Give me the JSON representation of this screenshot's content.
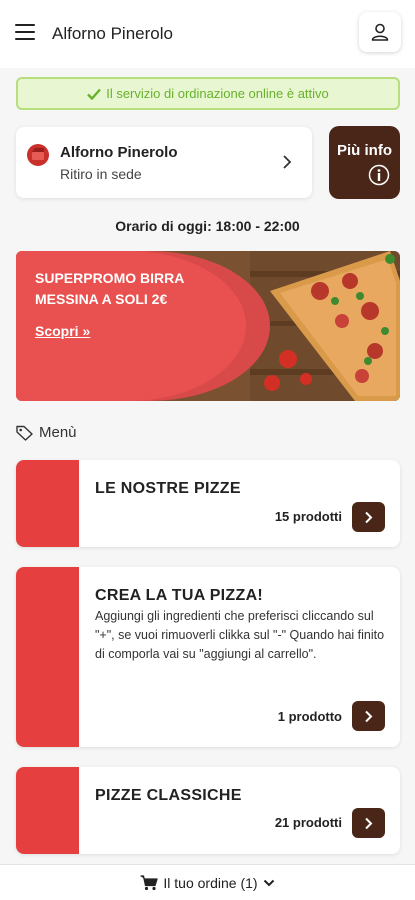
{
  "header": {
    "title": "Alforno Pinerolo"
  },
  "status": {
    "message": "Il servizio di ordinazione online è attivo",
    "color": "#67b22b"
  },
  "store": {
    "name": "Alforno Pinerolo",
    "mode": "Ritiro in sede"
  },
  "info_button": {
    "label": "Più info"
  },
  "hours": {
    "text": "Orario di oggi: 18:00 - 22:00"
  },
  "promo": {
    "title": "SUPERPROMO BIRRA MESSINA A SOLI 2€",
    "link": "Scopri"
  },
  "menu": {
    "label": "Menù"
  },
  "categories": [
    {
      "title": "LE NOSTRE PIZZE",
      "count": "15 prodotti"
    },
    {
      "title": "CREA LA TUA PIZZA!",
      "description": "Aggiungi gli ingredienti che preferisci cliccando sul \"+\", se vuoi rimuoverli clikka sul \"-\" Quando hai finito di comporla vai su \"aggiungi al carrello\".",
      "count": "1 prodotto"
    },
    {
      "title": "PIZZE CLASSICHE",
      "count": "21 prodotti"
    }
  ],
  "cart": {
    "label": "Il tuo ordine (1)"
  },
  "colors": {
    "accent_red": "#e5403f",
    "brown": "#4a2618",
    "green": "#67b22b"
  }
}
